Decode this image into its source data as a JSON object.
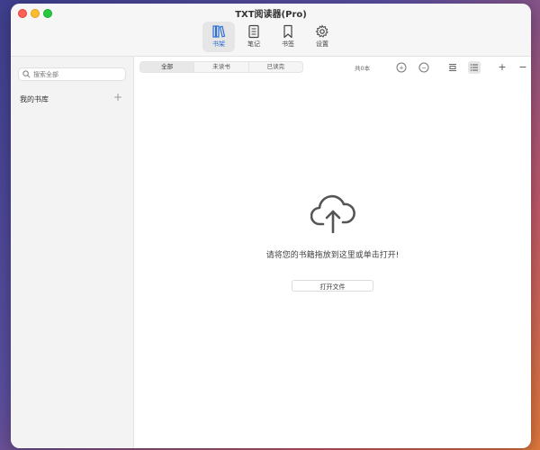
{
  "window": {
    "title": "TXT阅读器(Pro)"
  },
  "toolbar": {
    "items": [
      {
        "label": "书架",
        "icon": "bookshelf-icon",
        "active": true
      },
      {
        "label": "笔记",
        "icon": "notes-icon",
        "active": false
      },
      {
        "label": "书签",
        "icon": "bookmark-icon",
        "active": false
      },
      {
        "label": "设置",
        "icon": "gear-icon",
        "active": false
      }
    ]
  },
  "sidebar": {
    "search": {
      "placeholder": "搜索全部",
      "value": ""
    },
    "library_label": "我的书库",
    "add_symbol": "+"
  },
  "main": {
    "filter_tabs": [
      {
        "label": "全部",
        "active": true
      },
      {
        "label": "未读书",
        "active": false
      },
      {
        "label": "已读完",
        "active": false
      }
    ],
    "count_text": "共0本",
    "zoom_in_symbol": "+",
    "zoom_out_symbol": "−",
    "add_symbol": "+",
    "remove_symbol": "−",
    "empty": {
      "icon": "cloud-upload-icon",
      "message": "请将您的书籍拖放到这里或单击打开!",
      "open_button": "打开文件"
    }
  },
  "colors": {
    "accent": "#2d6fd6",
    "close": "#fe5f57",
    "minimize": "#febc2e",
    "maximize": "#28c840"
  }
}
